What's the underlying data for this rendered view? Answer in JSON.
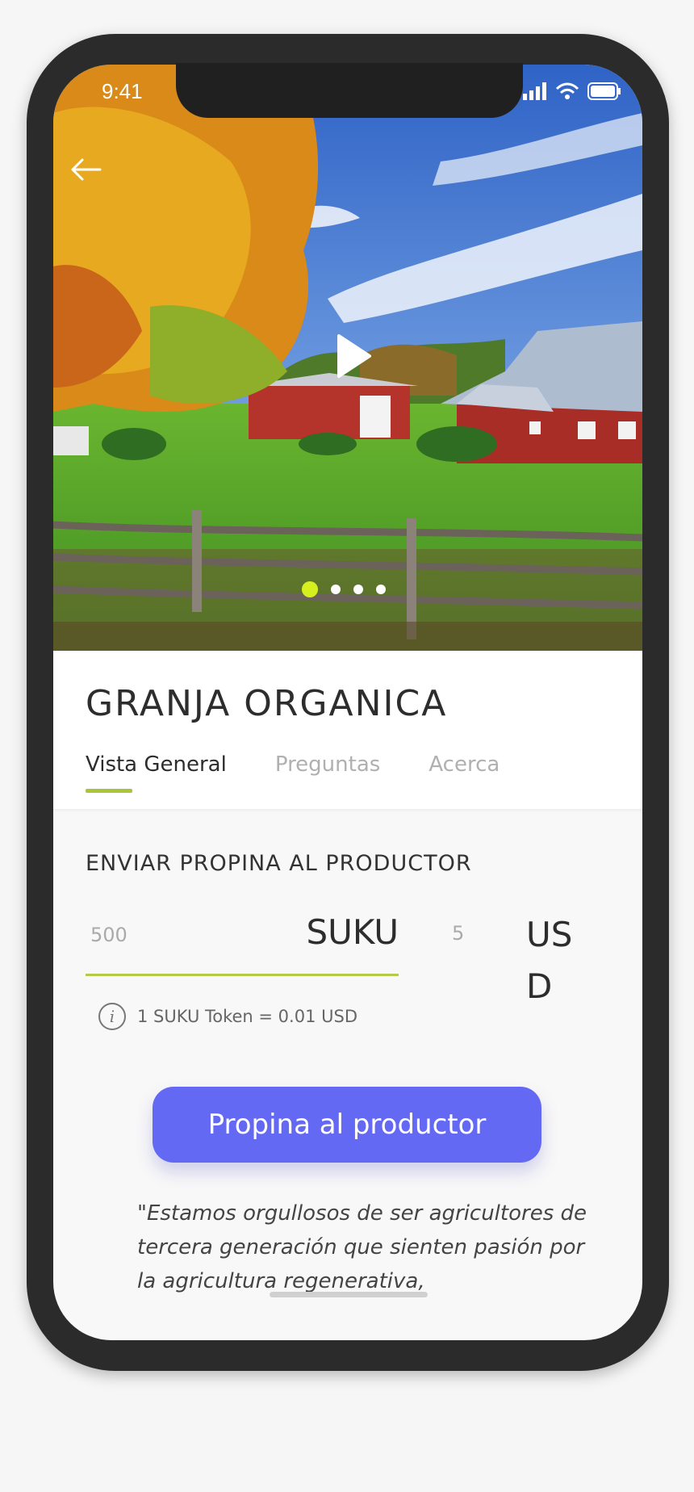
{
  "status_bar": {
    "time": "9:41"
  },
  "hero": {
    "active_slide": 1,
    "slide_count": 4
  },
  "farm": {
    "title": "GRANJA ORGANICA"
  },
  "tabs": [
    {
      "label": "Vista General",
      "active": true
    },
    {
      "label": "Preguntas",
      "active": false
    },
    {
      "label": "Acerca",
      "active": false
    }
  ],
  "tip": {
    "section_title": "ENVIAR PROPINA AL PRODUCTOR",
    "amount_value": "500",
    "amount_unit": "SUKU",
    "usd_value": "5",
    "usd_unit": "USD",
    "rate_info": "1 SUKU Token = 0.01 USD",
    "button_label": "Propina al productor"
  },
  "quote": "\"Estamos orgullosos de ser agricultores de tercera generación que sienten pasión por la agricultura regenerativa,",
  "colors": {
    "accent_button": "#6469f3",
    "tab_underline": "#a8c53d",
    "active_dot": "#d6f01f"
  }
}
